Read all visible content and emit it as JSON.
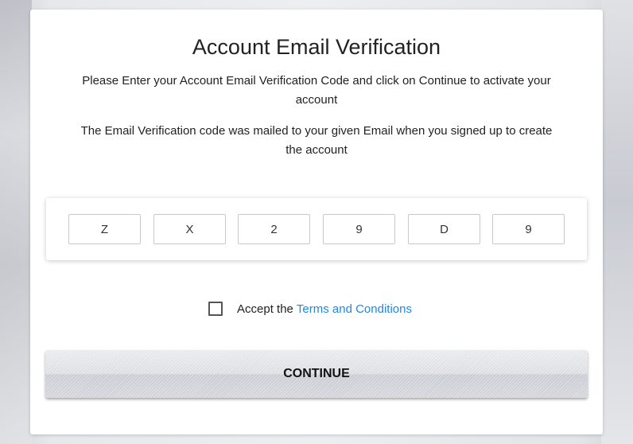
{
  "page": {
    "title": "Account Email Verification",
    "instruction": "Please Enter your Account Email Verification Code and click on Continue to activate your account",
    "note": "The Email Verification code was mailed to your given Email when you signed up to create the account"
  },
  "code": {
    "digits": [
      "Z",
      "X",
      "2",
      "9",
      "D",
      "9"
    ]
  },
  "terms": {
    "prefix": "Accept the",
    "link_label": "Terms and Conditions",
    "checked": false,
    "link_color": "#1e88e5"
  },
  "actions": {
    "continue_label": "CONTINUE"
  }
}
